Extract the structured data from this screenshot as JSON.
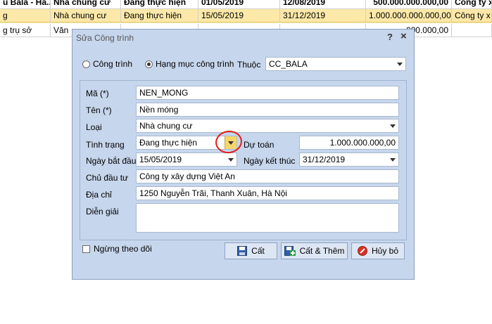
{
  "grid": {
    "header": [
      "u Bala - Ha...",
      "Nhà chung cư",
      "Đang thực hiện",
      "01/05/2019",
      "12/08/2019",
      "500.000.000.000,00",
      "Công ty xa"
    ],
    "selected_row": [
      "g",
      "Nhà chung cư",
      "Đang thực hiện",
      "15/05/2019",
      "31/12/2019",
      "1.000.000.000.000,00",
      "Công ty x"
    ],
    "row3": [
      "g trụ sở",
      "Văn",
      "",
      "",
      "",
      "000.000,00",
      ""
    ]
  },
  "dialog": {
    "title": "Sửa Công trình",
    "help": "?",
    "close": "×",
    "radio_cong_trinh": "Công trình",
    "radio_hang_muc": "Hạng mục công trình",
    "thuoc_label": "Thuộc",
    "thuoc_value": "CC_BALA",
    "ma_label": "Mã (*)",
    "ma_value": "NEN_MONG",
    "ten_label": "Tên (*)",
    "ten_value": "Nền móng",
    "loai_label": "Loại",
    "loai_value": "Nhà chung cư",
    "tinh_trang_label": "Tình trạng",
    "tinh_trang_value": "Đang thực hiện",
    "du_toan_label": "Dự toán",
    "du_toan_value": "1.000.000.000,00",
    "ngay_bat_dau_label": "Ngày bắt đầu",
    "ngay_bat_dau_value": "15/05/2019",
    "ngay_ket_thuc_label": "Ngày kết thúc",
    "ngay_ket_thuc_value": "31/12/2019",
    "chu_dau_tu_label": "Chủ đầu tư",
    "chu_dau_tu_value": "Công ty xây dựng Việt An",
    "dia_chi_label": "Địa chỉ",
    "dia_chi_value": "1250 Nguyễn Trãi, Thanh Xuân, Hà Nội",
    "dien_giai_label": "Diễn giải",
    "ngung_theo_doi": "Ngừng theo dõi",
    "btn_cat": "Cất",
    "btn_cat_them": "Cất & Thêm",
    "btn_huy_bo": "Hủy bỏ"
  }
}
